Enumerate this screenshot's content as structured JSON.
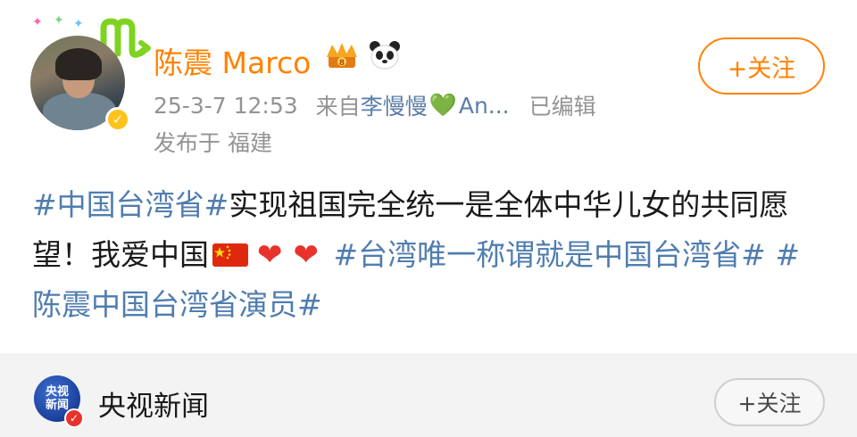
{
  "post": {
    "username": "陈震 Marco",
    "time": "25-3-7 12:53",
    "source_prefix": "来自",
    "source_name": "李慢慢",
    "source_heart": "💚",
    "source_suffix": "An...",
    "edited": "已编辑",
    "location": "发布于 福建",
    "follow_label": "+关注",
    "content": {
      "tag1": "#中国台湾省#",
      "text1": "实现祖国完全统一是全体中华儿女的共同愿望！我爱中国",
      "tag2": "#台湾唯一称谓就是中国台湾省#",
      "tag3": "#陈震中国台湾省演员#"
    },
    "icons": [
      "verified-icon",
      "crown-badge-icon",
      "panda-badge-icon",
      "china-flag-icon",
      "red-heart-icon",
      "zodiac-icon"
    ]
  },
  "next_card": {
    "logo_line1": "央视",
    "logo_line2": "新闻",
    "name": "央视新闻",
    "follow_label": "+关注"
  },
  "colors": {
    "accent": "#ff8200",
    "link": "#507daf",
    "meta_text": "#939393",
    "verified_gold": "#ffc21a",
    "heart_red": "#e8332c"
  }
}
